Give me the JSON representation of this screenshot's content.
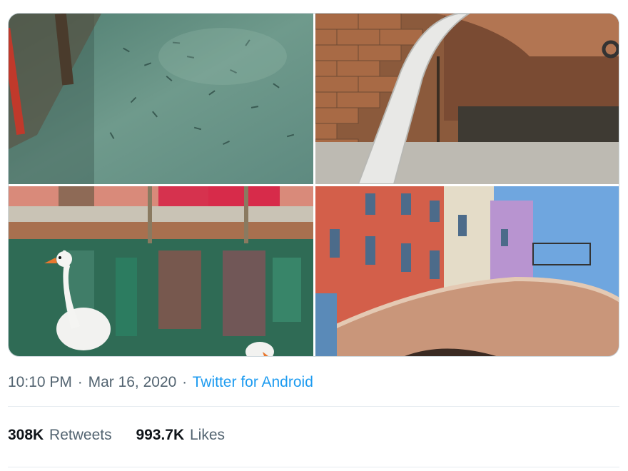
{
  "tweet": {
    "media": [
      {
        "name": "canal-fish-photo",
        "alt_kind": "photo"
      },
      {
        "name": "brick-arch-photo",
        "alt_kind": "photo"
      },
      {
        "name": "swan-canal-photo",
        "alt_kind": "photo"
      },
      {
        "name": "bridge-houses-photo",
        "alt_kind": "photo"
      }
    ],
    "time": "10:10 PM",
    "separator": "·",
    "date": "Mar 16, 2020",
    "source": "Twitter for Android",
    "stats": {
      "retweets_count": "308K",
      "retweets_label": "Retweets",
      "likes_count": "993.7K",
      "likes_label": "Likes"
    },
    "colors": {
      "link": "#1d9bf0",
      "meta_text": "#536471",
      "strong_text": "#0f1419",
      "divider": "#e6ecf0"
    }
  }
}
